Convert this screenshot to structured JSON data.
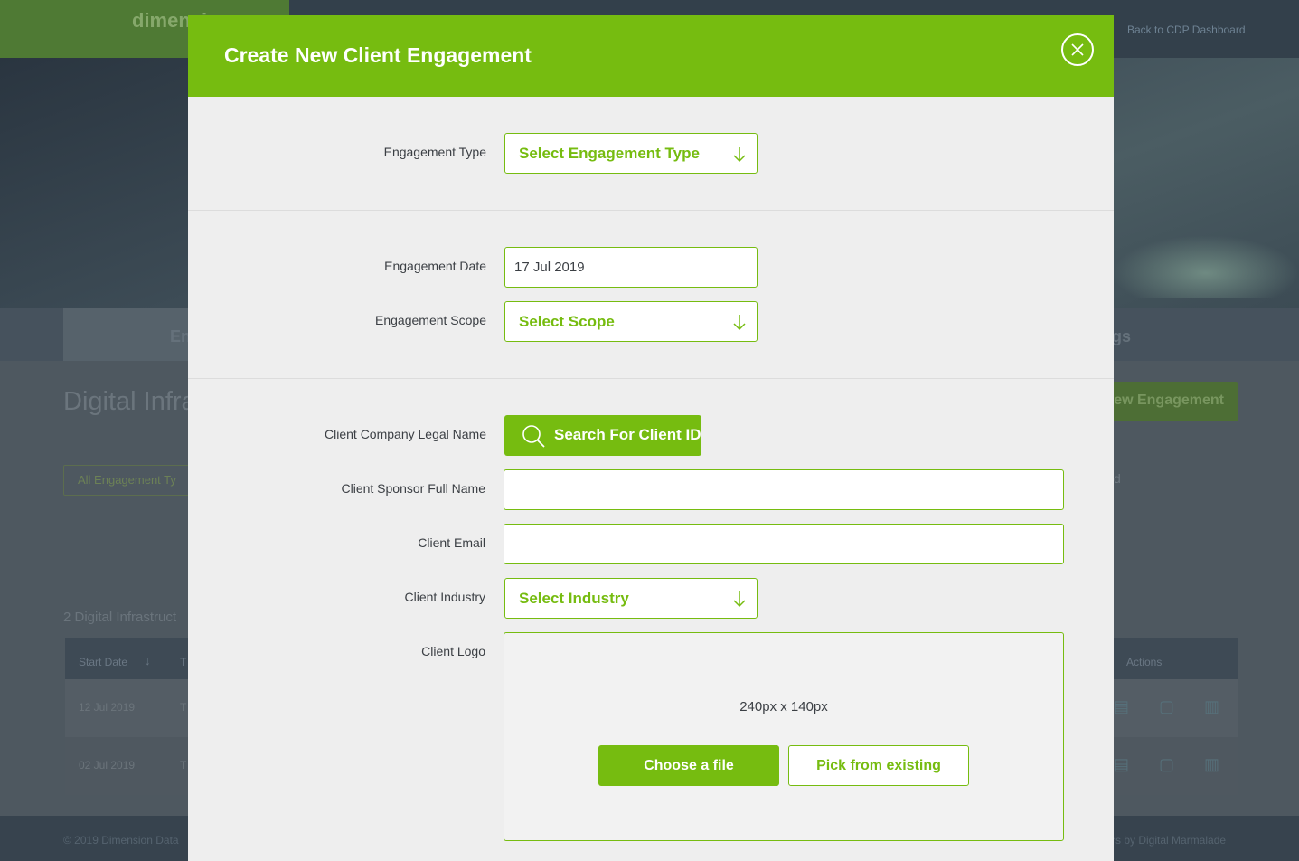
{
  "background": {
    "logo_text": "dimension",
    "back_link": "Back to CDP Dashboard",
    "tabs": [
      "En",
      "gs"
    ],
    "page_title": "Digital Infra",
    "new_engagement_button": "ew Engagement",
    "filter_label": "All Engagement Ty",
    "side_letter": "d",
    "count_text": "2 Digital Infrastruct",
    "table": {
      "headers": [
        "Start Date",
        "T",
        "Actions"
      ],
      "rows": [
        {
          "start_date": "12 Jul 2019",
          "col2": "T"
        },
        {
          "start_date": "02 Jul 2019",
          "col2": "T"
        }
      ]
    },
    "footer_left": "© 2019 Dimension Data",
    "footer_right": "rs by Digital Marmalade"
  },
  "modal": {
    "title": "Create New Client Engagement",
    "close_icon": "close-icon",
    "accent_color": "#76bc10",
    "fields": {
      "engagement_type": {
        "label": "Engagement Type",
        "value": "Select Engagement Type"
      },
      "engagement_date": {
        "label": "Engagement Date",
        "value": "17 Jul 2019"
      },
      "engagement_scope": {
        "label": "Engagement Scope",
        "value": "Select Scope"
      },
      "client_company": {
        "label": "Client Company Legal Name",
        "button": "Search For Client ID"
      },
      "client_sponsor": {
        "label": "Client Sponsor Full Name",
        "value": ""
      },
      "client_email": {
        "label": "Client Email",
        "value": ""
      },
      "client_industry": {
        "label": "Client Industry",
        "value": "Select Industry"
      },
      "client_logo": {
        "label": "Client Logo",
        "size_hint": "240px x 140px",
        "choose_button": "Choose a file",
        "pick_button": "Pick from existing"
      }
    }
  }
}
